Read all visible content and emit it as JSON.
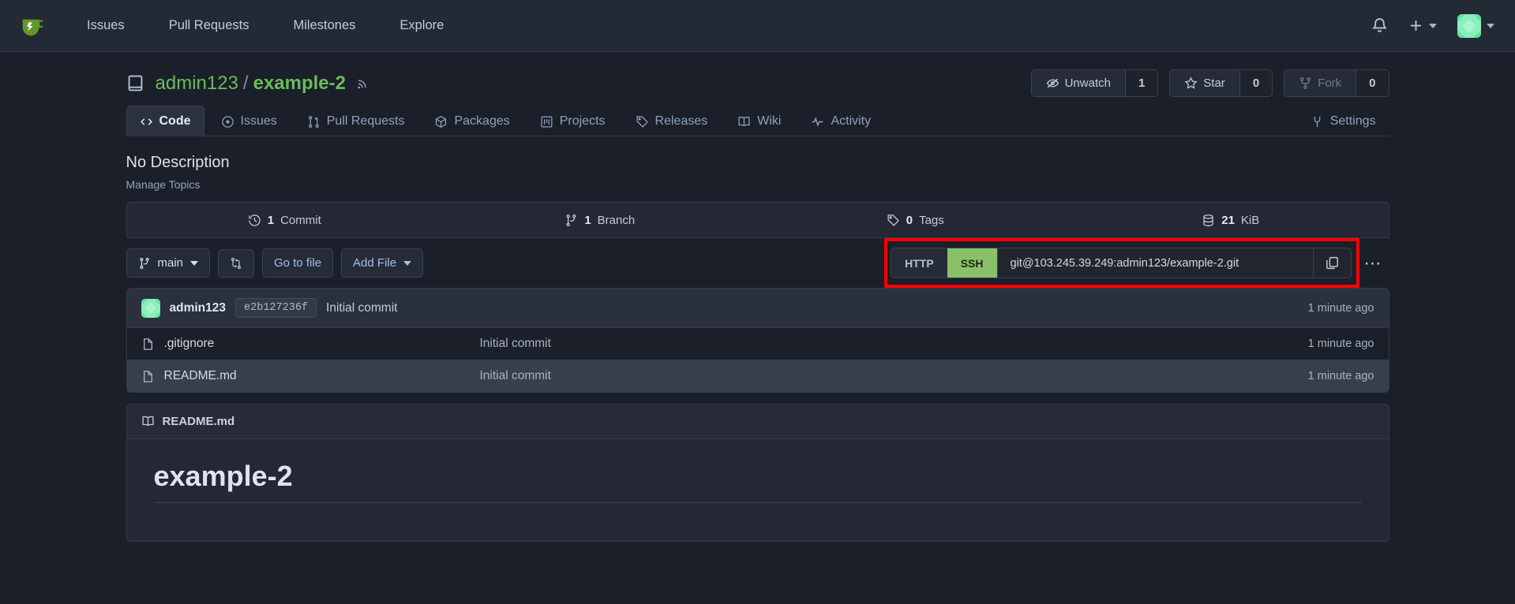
{
  "topnav": {
    "logo_icon": "gitea-logo-icon",
    "links": [
      "Issues",
      "Pull Requests",
      "Milestones",
      "Explore"
    ],
    "bell_icon": "bell-icon",
    "plus_icon": "plus-icon",
    "avatar_icon": "user-avatar"
  },
  "repo": {
    "icon": "repo-book-icon",
    "owner": "admin123",
    "separator": "/",
    "name": "example-2",
    "rss_icon": "rss-icon",
    "actions": [
      {
        "icon": "eye-closed-icon",
        "label": "Unwatch",
        "count": "1",
        "dim": false
      },
      {
        "icon": "star-icon",
        "label": "Star",
        "count": "0",
        "dim": false
      },
      {
        "icon": "fork-icon",
        "label": "Fork",
        "count": "0",
        "dim": true
      }
    ]
  },
  "tabs": [
    {
      "icon": "code-icon",
      "label": "Code",
      "active": true
    },
    {
      "icon": "issue-opened-icon",
      "label": "Issues",
      "active": false
    },
    {
      "icon": "git-pull-request-icon",
      "label": "Pull Requests",
      "active": false
    },
    {
      "icon": "package-icon",
      "label": "Packages",
      "active": false
    },
    {
      "icon": "project-icon",
      "label": "Projects",
      "active": false
    },
    {
      "icon": "tag-icon",
      "label": "Releases",
      "active": false
    },
    {
      "icon": "book-icon",
      "label": "Wiki",
      "active": false
    },
    {
      "icon": "pulse-icon",
      "label": "Activity",
      "active": false
    }
  ],
  "settings_tab": {
    "icon": "tools-icon",
    "label": "Settings"
  },
  "description": {
    "text": "No Description",
    "manage_topics": "Manage Topics"
  },
  "stats": [
    {
      "icon": "history-icon",
      "count": "1",
      "label": "Commit"
    },
    {
      "icon": "branch-icon",
      "count": "1",
      "label": "Branch"
    },
    {
      "icon": "tag-icon",
      "count": "0",
      "label": "Tags"
    },
    {
      "icon": "database-icon",
      "count": "21",
      "label": "KiB"
    }
  ],
  "actionrow": {
    "branch": "main",
    "branch_icon": "git-branch-icon",
    "compare_icon": "git-compare-icon",
    "go_to_file": "Go to file",
    "add_file": "Add File"
  },
  "clone": {
    "http_label": "HTTP",
    "ssh_label": "SSH",
    "active_protocol": "SSH",
    "url": "git@103.245.39.249:admin123/example-2.git",
    "copy_icon": "copy-icon",
    "more_icon": "ellipsis-icon",
    "highlight_color": "#ff0000"
  },
  "commit_row": {
    "author": "admin123",
    "sha": "e2b127236f",
    "message": "Initial commit",
    "when": "1 minute ago"
  },
  "files": [
    {
      "icon": "file-icon",
      "name": ".gitignore",
      "message": "Initial commit",
      "when": "1 minute ago",
      "highlighted": false
    },
    {
      "icon": "file-icon",
      "name": "README.md",
      "message": "Initial commit",
      "when": "1 minute ago",
      "highlighted": true
    }
  ],
  "readme": {
    "icon": "book-icon",
    "title": "README.md",
    "heading": "example-2"
  }
}
